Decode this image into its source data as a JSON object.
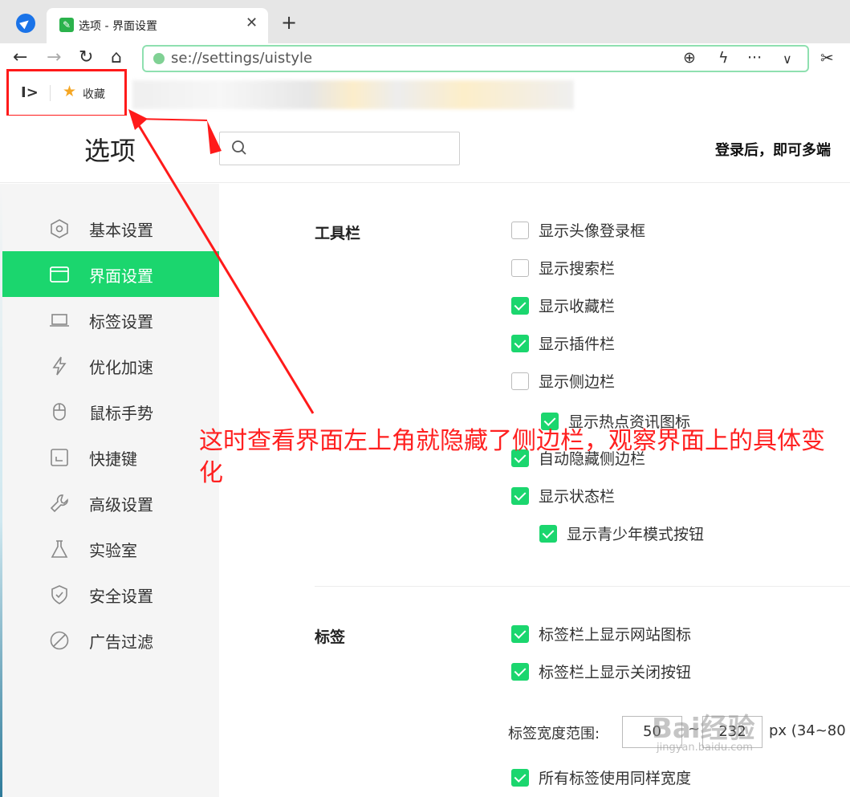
{
  "tab": {
    "title": "选项 - 界面设置"
  },
  "address": {
    "url": "se://settings/uistyle"
  },
  "bookmarks_bar": {
    "favorites_label": "收藏"
  },
  "header": {
    "title": "选项",
    "search_placeholder": "",
    "login_hint": "登录后，即可多端"
  },
  "sidebar": {
    "items": [
      {
        "label": "基本设置",
        "icon": "hexagon-settings-icon",
        "active": false
      },
      {
        "label": "界面设置",
        "icon": "window-icon",
        "active": true
      },
      {
        "label": "标签设置",
        "icon": "laptop-tab-icon",
        "active": false
      },
      {
        "label": "优化加速",
        "icon": "lightning-icon",
        "active": false
      },
      {
        "label": "鼠标手势",
        "icon": "mouse-icon",
        "active": false
      },
      {
        "label": "快捷键",
        "icon": "shortcut-key-icon",
        "active": false
      },
      {
        "label": "高级设置",
        "icon": "wrench-icon",
        "active": false
      },
      {
        "label": "实验室",
        "icon": "flask-icon",
        "active": false
      },
      {
        "label": "安全设置",
        "icon": "shield-icon",
        "active": false
      },
      {
        "label": "广告过滤",
        "icon": "block-icon",
        "active": false
      }
    ]
  },
  "toolbar_section": {
    "title": "工具栏",
    "options": [
      {
        "label": "显示头像登录框",
        "checked": false
      },
      {
        "label": "显示搜索栏",
        "checked": false
      },
      {
        "label": "显示收藏栏",
        "checked": true
      },
      {
        "label": "显示插件栏",
        "checked": true
      },
      {
        "label": "显示侧边栏",
        "checked": false
      },
      {
        "label": "显示热点资讯图标",
        "checked": true
      },
      {
        "label": "自动隐藏侧边栏",
        "checked": true
      },
      {
        "label": "显示状态栏",
        "checked": true
      },
      {
        "label": "显示青少年模式按钮",
        "checked": true
      }
    ]
  },
  "tab_section": {
    "title": "标签",
    "options": [
      {
        "label": "标签栏上显示网站图标",
        "checked": true
      },
      {
        "label": "标签栏上显示关闭按钮",
        "checked": true
      },
      {
        "label": "所有标签使用同样宽度",
        "checked": true
      }
    ],
    "width_range": {
      "label": "标签宽度范围:",
      "min": "50",
      "separator": "~",
      "max": "232",
      "hint": "px (34~80"
    }
  },
  "annotation": {
    "text": "这时查看界面左上角就隐藏了侧边栏，观察界面上的具体变化"
  },
  "watermark": {
    "text": "Bai经验",
    "sub": "jingyan.baidu.com"
  },
  "colors": {
    "accent": "#1bd66e",
    "annotation": "#ff2020"
  }
}
